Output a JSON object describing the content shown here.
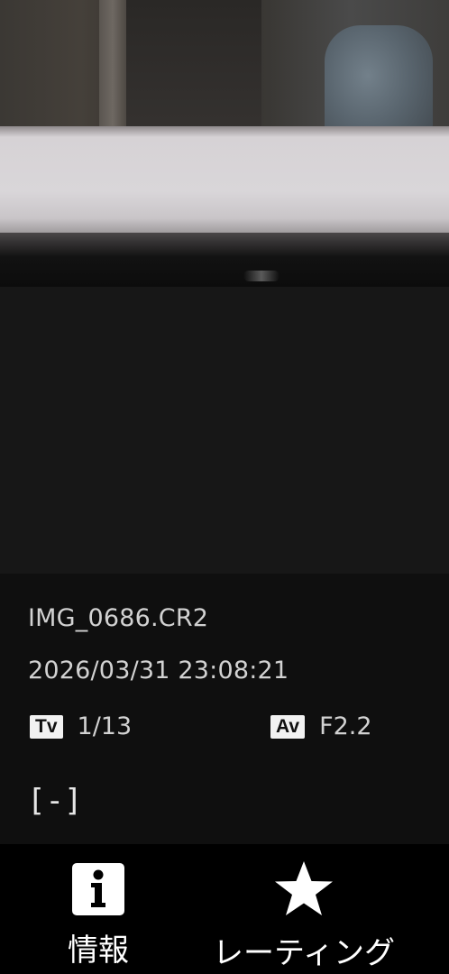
{
  "photo": {
    "description_icon": "photo-preview"
  },
  "info": {
    "filename": "IMG_0686.CR2",
    "datetime": "2026/03/31 23:08:21",
    "tv_badge": "Tv",
    "tv_value": "1/13",
    "av_badge": "Av",
    "av_value": "F2.2",
    "focus_indicator": "[-]"
  },
  "toolbar": {
    "items": [
      {
        "label": "情報",
        "icon": "info-icon"
      },
      {
        "label": "レーティング",
        "icon": "star-icon"
      },
      {
        "label": "",
        "icon": "partial-icon"
      }
    ]
  },
  "colors": {
    "background": "#171717",
    "panel": "#0f0f0f",
    "toolbar": "#000000",
    "text": "#d2d2d2",
    "icon": "#ffffff"
  }
}
